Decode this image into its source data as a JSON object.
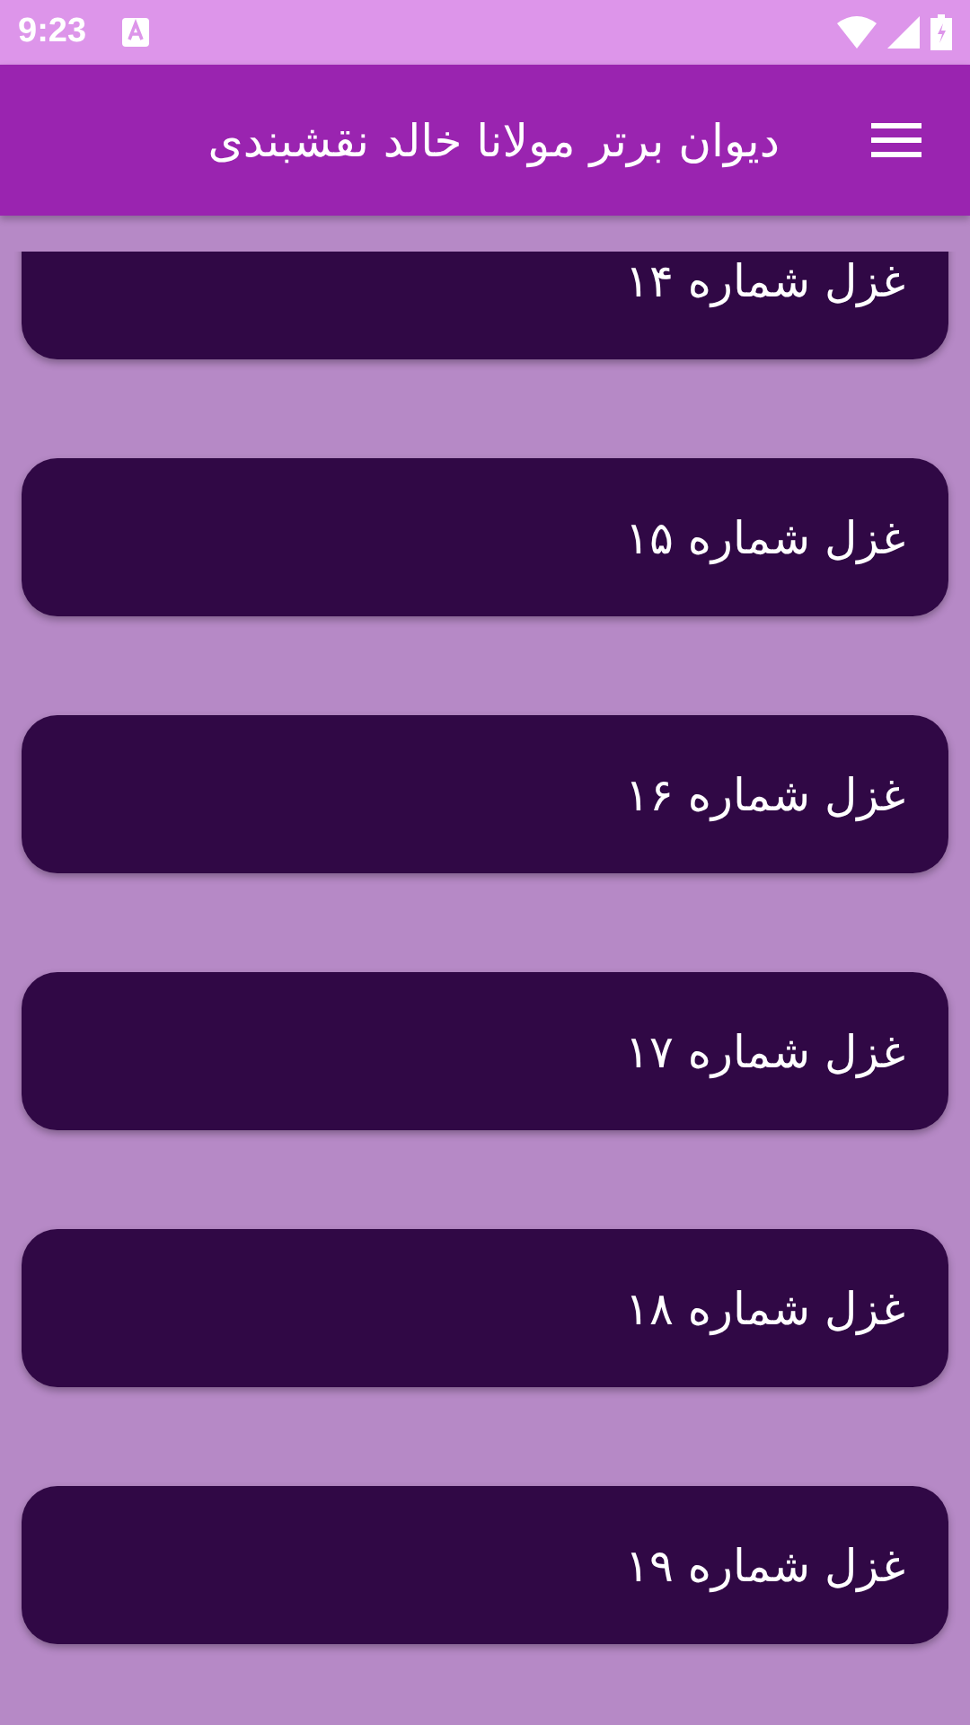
{
  "status_bar": {
    "time": "9:23"
  },
  "app_bar": {
    "title": "دیوان برتر مولانا خالد نقشبندی"
  },
  "items": [
    {
      "label": "غزل شماره ۱۴"
    },
    {
      "label": "غزل شماره ۱۵"
    },
    {
      "label": "غزل شماره ۱۶"
    },
    {
      "label": "غزل شماره ۱۷"
    },
    {
      "label": "غزل شماره ۱۸"
    },
    {
      "label": "غزل شماره ۱۹"
    }
  ]
}
